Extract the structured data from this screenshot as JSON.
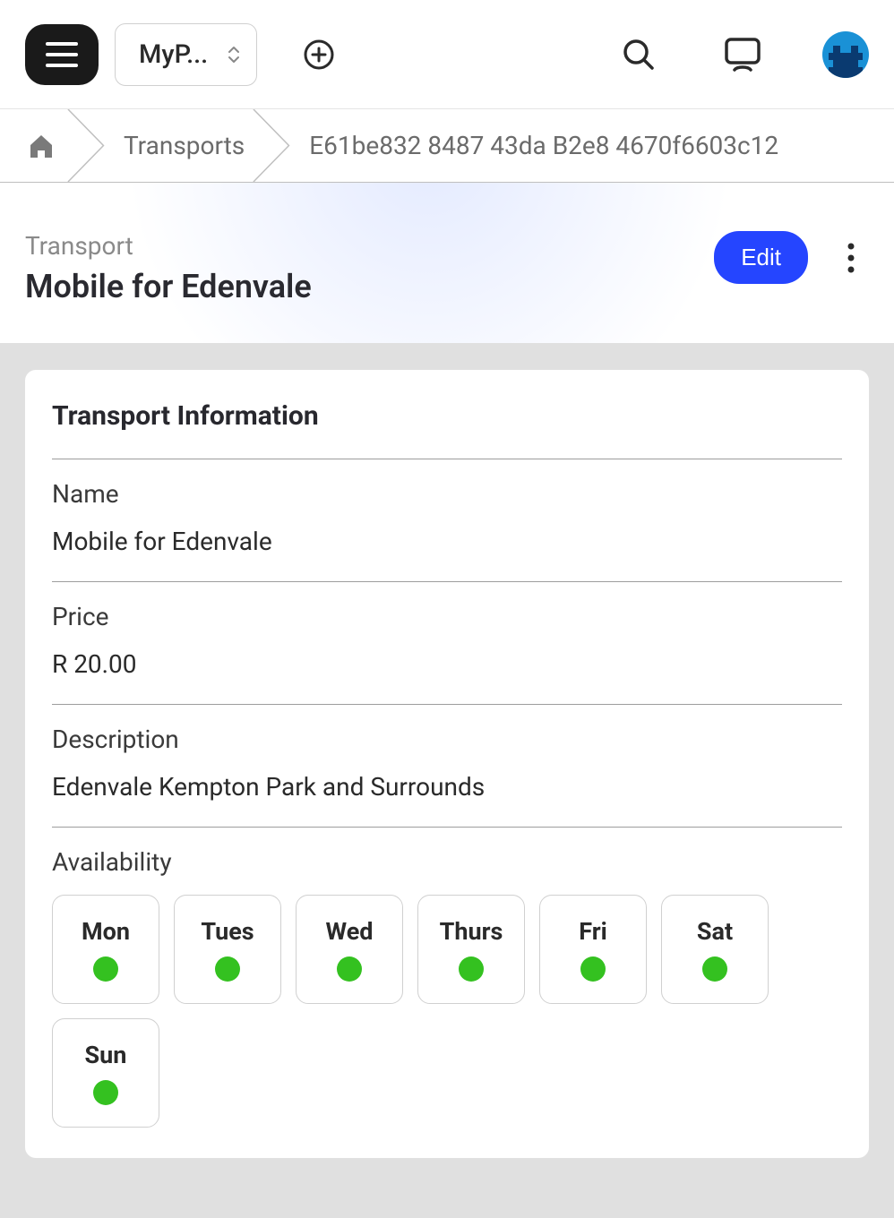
{
  "topbar": {
    "project_label": "MyP..."
  },
  "breadcrumb": {
    "section": "Transports",
    "id": "E61be832 8487 43da B2e8 4670f6603c12"
  },
  "header": {
    "eyebrow": "Transport",
    "title": "Mobile for Edenvale",
    "edit_label": "Edit"
  },
  "card": {
    "title": "Transport Information",
    "fields": {
      "name_label": "Name",
      "name_value": "Mobile for Edenvale",
      "price_label": "Price",
      "price_value": "R 20.00",
      "description_label": "Description",
      "description_value": "Edenvale Kempton Park and Surrounds"
    },
    "availability": {
      "label": "Availability",
      "days": [
        {
          "label": "Mon",
          "available": true
        },
        {
          "label": "Tues",
          "available": true
        },
        {
          "label": "Wed",
          "available": true
        },
        {
          "label": "Thurs",
          "available": true
        },
        {
          "label": "Fri",
          "available": true
        },
        {
          "label": "Sat",
          "available": true
        },
        {
          "label": "Sun",
          "available": true
        }
      ]
    }
  }
}
